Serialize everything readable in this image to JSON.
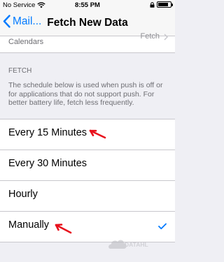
{
  "status_bar": {
    "carrier": "No Service",
    "time": "8:55 PM",
    "battery_level": 0.8
  },
  "nav": {
    "back_label": "Mail...",
    "title": "Fetch New Data"
  },
  "partial_row": {
    "label": "Calendars",
    "value": "Fetch"
  },
  "fetch_section": {
    "header": "FETCH",
    "footer": "The schedule below is used when push is off or for applications that do not support push. For better battery life, fetch less frequently.",
    "options": [
      "Every 15 Minutes",
      "Every 30 Minutes",
      "Hourly",
      "Manually"
    ],
    "selected": "Manually"
  },
  "watermark": {
    "text": "DATAHL"
  },
  "colors": {
    "accent": "#007aff",
    "annotation_arrow": "#e8101c",
    "background": "#efeff4"
  }
}
